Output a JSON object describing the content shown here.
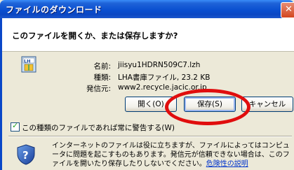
{
  "window": {
    "title": "ファイルのダウンロード"
  },
  "header": {
    "question": "このファイルを開くか、または保存しますか?"
  },
  "file": {
    "name_label": "名前:",
    "name_value": "jiisyu1HDRN509C7.lzh",
    "type_label": "種類:",
    "type_value": "LHA書庫ファイル, 23.2 KB",
    "source_label": "発信元:",
    "source_value": "www2.recycle.jacic.or.jp",
    "icon": "lha-archive-icon"
  },
  "buttons": {
    "open": "開く(O)",
    "save": "保存(S)",
    "cancel": "キャンセル"
  },
  "checkbox": {
    "label": "この種類のファイルであれば常に警告する(W)",
    "checked": true
  },
  "warning": {
    "text": "インターネットのファイルは役に立ちますが、ファイルによってはコンピュータに問題を起こすものもあります。発信元が信頼できない場合は、このファイルを開いたり保存したりしないでください。",
    "link": "危険性の説明",
    "icon": "shield-question-icon"
  },
  "annotation": {
    "color": "#e00d0d"
  }
}
